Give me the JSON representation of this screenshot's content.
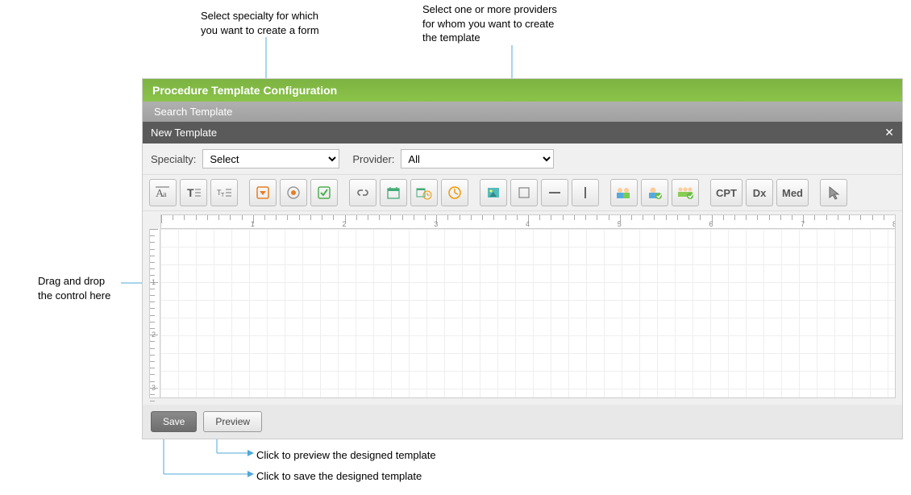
{
  "annotations": {
    "specialty": "Select specialty for which\nyou want to create a form",
    "provider": "Select one or more providers\nfor whom you want to create\nthe template",
    "dragdrop": "Drag and drop\nthe control here",
    "preview": "Click to preview the designed template",
    "save": "Click to save the designed template"
  },
  "header": {
    "title": "Procedure Template Configuration",
    "search_label": "Search Template",
    "newtemplate_label": "New Template"
  },
  "form": {
    "specialty_label": "Specialty:",
    "specialty_value": "Select",
    "provider_label": "Provider:",
    "provider_value": "All"
  },
  "toolbar": {
    "cpt": "CPT",
    "dx": "Dx",
    "med": "Med"
  },
  "footer": {
    "save": "Save",
    "preview": "Preview"
  }
}
